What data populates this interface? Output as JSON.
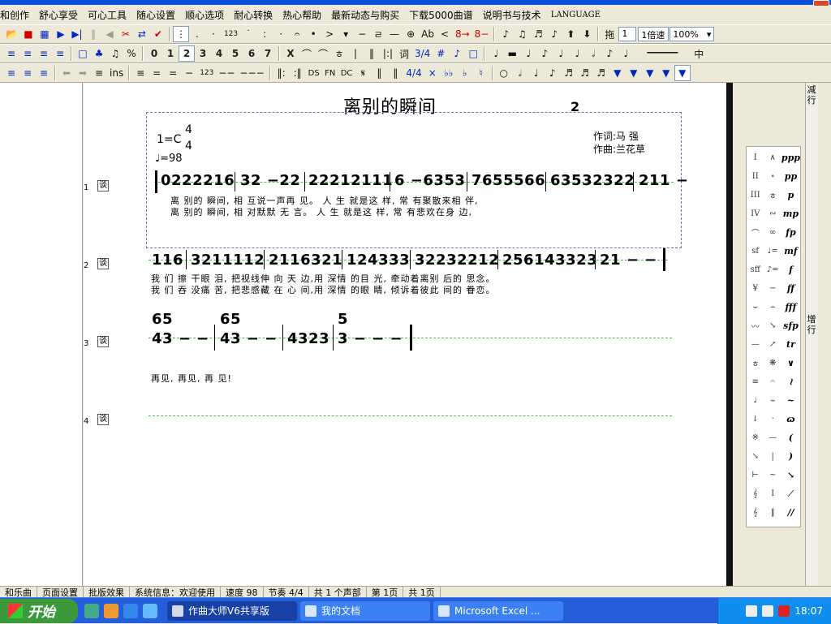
{
  "menu": {
    "items": [
      "和创作",
      "舒心享受",
      "可心工具",
      "随心设置",
      "顺心选项",
      "耐心转换",
      "热心帮助",
      "最新动态与购买",
      "下载5000曲谱",
      "说明书与技术",
      "LANGUAGE"
    ]
  },
  "toolbar1": {
    "number_123": "123",
    "acc_ab": "Ab",
    "oct_up": "8→",
    "oct_down": "8−",
    "drag_label": "拖",
    "field_value": "1",
    "speed_value": "1倍速",
    "zoom_value": "100%"
  },
  "toolbar2": {
    "digits": [
      "0",
      "1",
      "2",
      "3",
      "4",
      "5",
      "6",
      "7"
    ],
    "rest_x": "X",
    "lyric_label": "词",
    "ts_label": "3/4",
    "sharp": "#",
    "center_label": "中"
  },
  "toolbar3": {
    "ins_label": "ins",
    "number_123": "123",
    "ds": "DS",
    "fn": "FN",
    "dc": "DC",
    "ts_label": "4/4"
  },
  "score": {
    "title": "离别的瞬间",
    "page_number": "2",
    "key": "1=C",
    "time_top": "4",
    "time_bottom": "4",
    "tempo": "=98",
    "lyricist": "作词:马  强",
    "composer": "作曲:兰花草",
    "row_labels": [
      "1",
      "2",
      "3",
      "4"
    ],
    "row_icon": "谈",
    "rows": {
      "row1_notes": [
        "0222216",
        "32 −22",
        "22212111",
        "6 −6353",
        "7655566",
        "63532322",
        "211 −"
      ],
      "row1_lyric1": "离    别的  瞬间,    相    互说一声再      见。  人  生    就是这    样,    常  有聚散来相    伴,",
      "row1_lyric2": "离    别的  瞬间,    相    对默默  无      言。  人  生    就是这    样,    常  有悲欢在身    边,",
      "row2_notes": [
        "116",
        "3211112",
        "2116321",
        "124333",
        "32232212",
        "256143323",
        "21 − −"
      ],
      "row2_lyric1": "我   们  擦  干眼    泪, 把视线伸  向  天    边,用  深情  的目    光,  牵动着离别    后的  思念。",
      "row2_lyric2": "我   们  吞  没痛    苦, 把悲感藏  在  心    间,用  深情  的眼    睛,  倾诉着彼此    间的  眷恋。",
      "row3_top": [
        "65",
        "65",
        "5"
      ],
      "row3_bottom": [
        "43 − −",
        "43 − −",
        "4323",
        "3 − − −"
      ],
      "row3_lyric": "再见,          再见,          再          见!"
    }
  },
  "palette": {
    "items": [
      "I",
      "∧",
      "ppp",
      "II",
      "∘",
      "pp",
      "III",
      "ㅎ",
      "p",
      "IV",
      "∾",
      "mp",
      "⌒",
      "∞",
      "fp",
      "sf",
      "♩=",
      "mf",
      "sff",
      "♪=",
      "f",
      "¥",
      "−",
      "ff",
      "⌣",
      "⌢",
      "fff",
      "〰",
      "↘",
      "sfp",
      "—",
      "↗",
      "tr",
      "ㅎ",
      "❋",
      "∨",
      "≡",
      "𝄐",
      "≀",
      "♩",
      "⌣",
      "~",
      "↓",
      "·",
      "ɷ",
      "※",
      "—",
      "(",
      "↘",
      "|",
      ")",
      "⊢",
      "~",
      "↘",
      "𝄞",
      "I",
      "⁄",
      "𝄞",
      "‖",
      "//"
    ]
  },
  "right_panel": {
    "zoom_out": "减行",
    "zoom_in": "增行"
  },
  "statusbar": {
    "cells": [
      "和乐曲",
      "页面设置",
      "批版效果",
      "系统信息：欢迎使用",
      "速度 98",
      "节奏 4/4",
      "共 1 个声部",
      "第 1页",
      "共 1页"
    ]
  },
  "taskbar": {
    "start_label": "开始",
    "tasks": [
      "作曲大师V6共享版",
      "我的文档",
      "Microsoft Excel ..."
    ],
    "clock": "18:07"
  },
  "colors": {
    "accent": "#0a50d8",
    "taskbar": "#245edb",
    "start": "#3c9a3c",
    "guide_line": "#48c048"
  }
}
